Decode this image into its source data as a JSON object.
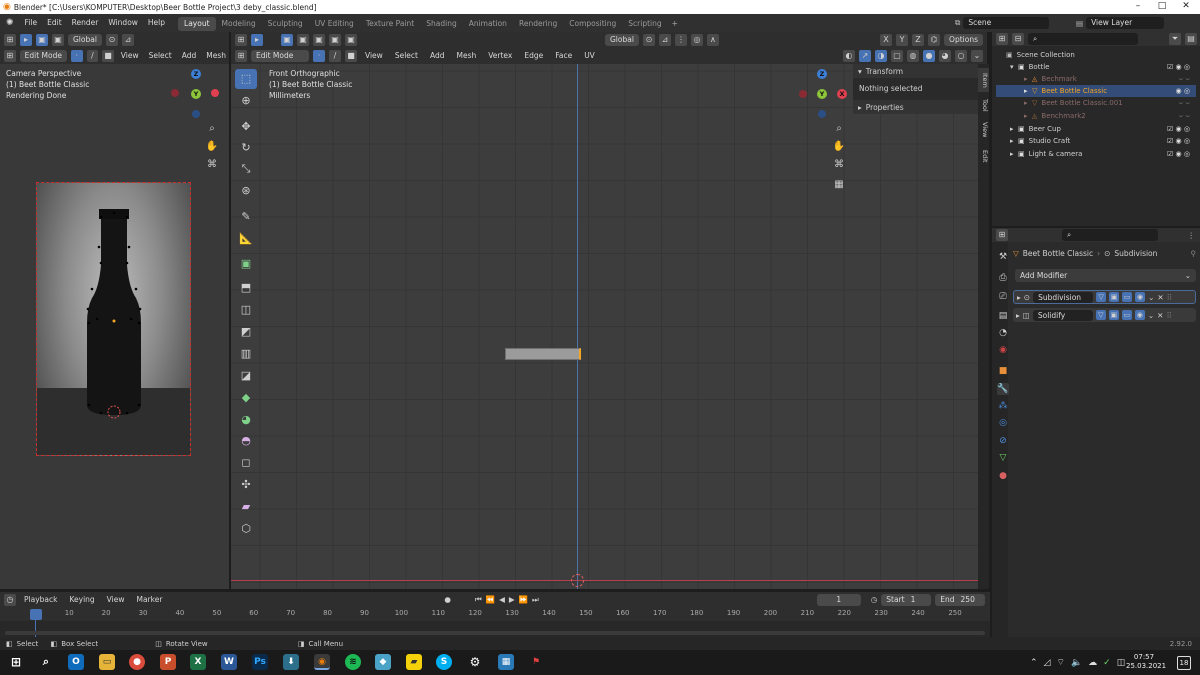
{
  "window": {
    "title": "Blender* [C:\\Users\\KOMPUTER\\Desktop\\Beer Bottle Project\\3 deby_classic.blend]"
  },
  "menu": [
    "File",
    "Edit",
    "Render",
    "Window",
    "Help"
  ],
  "workspaces": [
    "Layout",
    "Modeling",
    "Sculpting",
    "UV Editing",
    "Texture Paint",
    "Shading",
    "Animation",
    "Rendering",
    "Compositing",
    "Scripting"
  ],
  "scene": {
    "name": "Scene",
    "view_layer": "View Layer"
  },
  "left_view": {
    "mode": "Edit Mode",
    "orientation": "Global",
    "menu": [
      "View",
      "Select",
      "Add",
      "Mesh"
    ],
    "overlay": [
      "Camera Perspective",
      "(1) Beet Bottle Classic",
      "Rendering Done"
    ]
  },
  "main_view": {
    "mode": "Edit Mode",
    "orientation": "Global",
    "menu": [
      "View",
      "Select",
      "Add",
      "Mesh",
      "Vertex",
      "Edge",
      "Face",
      "UV"
    ],
    "overlay": [
      "Front Orthographic",
      "(1) Beet Bottle Classic",
      "Millimeters"
    ],
    "axes": {
      "x": "X",
      "y": "Y",
      "z": "Z"
    },
    "xyz_toggle": [
      "X",
      "Y",
      "Z"
    ],
    "options": "Options"
  },
  "sidebar": {
    "transform": "Transform",
    "nothing": "Nothing selected",
    "properties": "Properties",
    "tabs": [
      "Item",
      "Tool",
      "View",
      "Edit"
    ]
  },
  "outliner": {
    "root": "Scene Collection",
    "items": [
      "Bottle",
      "Bechmark",
      "Beet Bottle Classic",
      "Beet Bottle Classic.001",
      "Benchmark2",
      "Beer Cup",
      "Studio Craft",
      "Light & camera"
    ]
  },
  "properties": {
    "object": "Beet Bottle Classic",
    "modifier_tab": "Subdivision",
    "add_modifier": "Add Modifier",
    "modifiers": [
      "Subdivision",
      "Solidify"
    ]
  },
  "timeline": {
    "menu": [
      "Playback",
      "Keying",
      "View",
      "Marker"
    ],
    "current_frame": "1",
    "start_label": "Start",
    "start": "1",
    "end_label": "End",
    "end": "250",
    "ticks": [
      "1",
      "10",
      "20",
      "30",
      "40",
      "50",
      "60",
      "70",
      "80",
      "90",
      "100",
      "110",
      "120",
      "130",
      "140",
      "150",
      "160",
      "170",
      "180",
      "190",
      "200",
      "210",
      "220",
      "230",
      "240",
      "250"
    ]
  },
  "statusbar": {
    "items": [
      "Select",
      "Box Select",
      "Rotate View",
      "Call Menu"
    ],
    "version": "2.92.0"
  },
  "taskbar": {
    "time": "07:57",
    "date": "25.03.2021",
    "badge": "18"
  },
  "colors": {
    "accent": "#4772b3",
    "selected_orange": "#f5a623",
    "x_axis": "#e0404f",
    "y_axis": "#8cc43a",
    "z_axis": "#3d7fd6"
  }
}
